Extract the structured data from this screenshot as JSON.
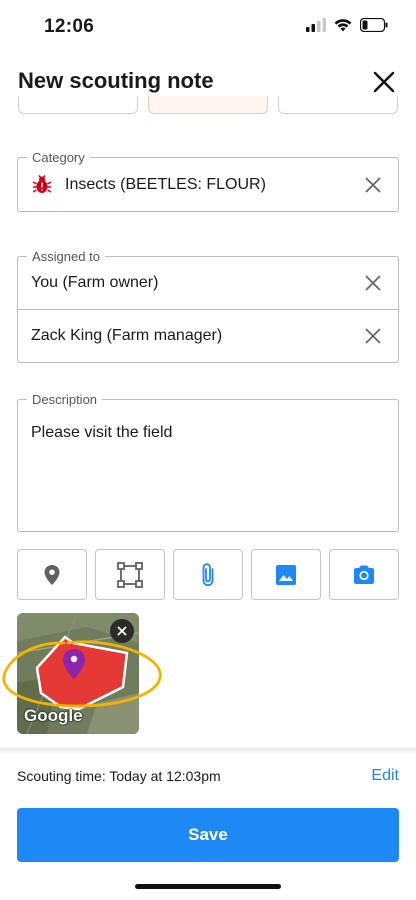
{
  "status_bar": {
    "time": "12:06"
  },
  "header": {
    "title": "New scouting note"
  },
  "category": {
    "legend": "Category",
    "value": "Insects (BEETLES: FLOUR)",
    "icon": "bug-icon",
    "icon_color": "#d0021b"
  },
  "assigned": {
    "legend": "Assigned to",
    "items": [
      {
        "label": "You (Farm owner)"
      },
      {
        "label": "Zack King (Farm manager)"
      }
    ]
  },
  "description": {
    "legend": "Description",
    "value": "Please visit the field"
  },
  "tools": [
    {
      "icon": "location-pin-icon"
    },
    {
      "icon": "draw-area-icon"
    },
    {
      "icon": "paperclip-icon"
    },
    {
      "icon": "image-icon"
    },
    {
      "icon": "camera-icon"
    }
  ],
  "map_attachment": {
    "label": "Google",
    "marker_color": "#8e24aa",
    "field_color": "#e53935",
    "highlight_color": "#f5b300"
  },
  "footer": {
    "scouting_time": "Scouting time: Today at 12:03pm",
    "edit_label": "Edit",
    "save_label": "Save"
  },
  "colors": {
    "accent": "#1e88f5",
    "tool_icon_grey": "#616161"
  }
}
